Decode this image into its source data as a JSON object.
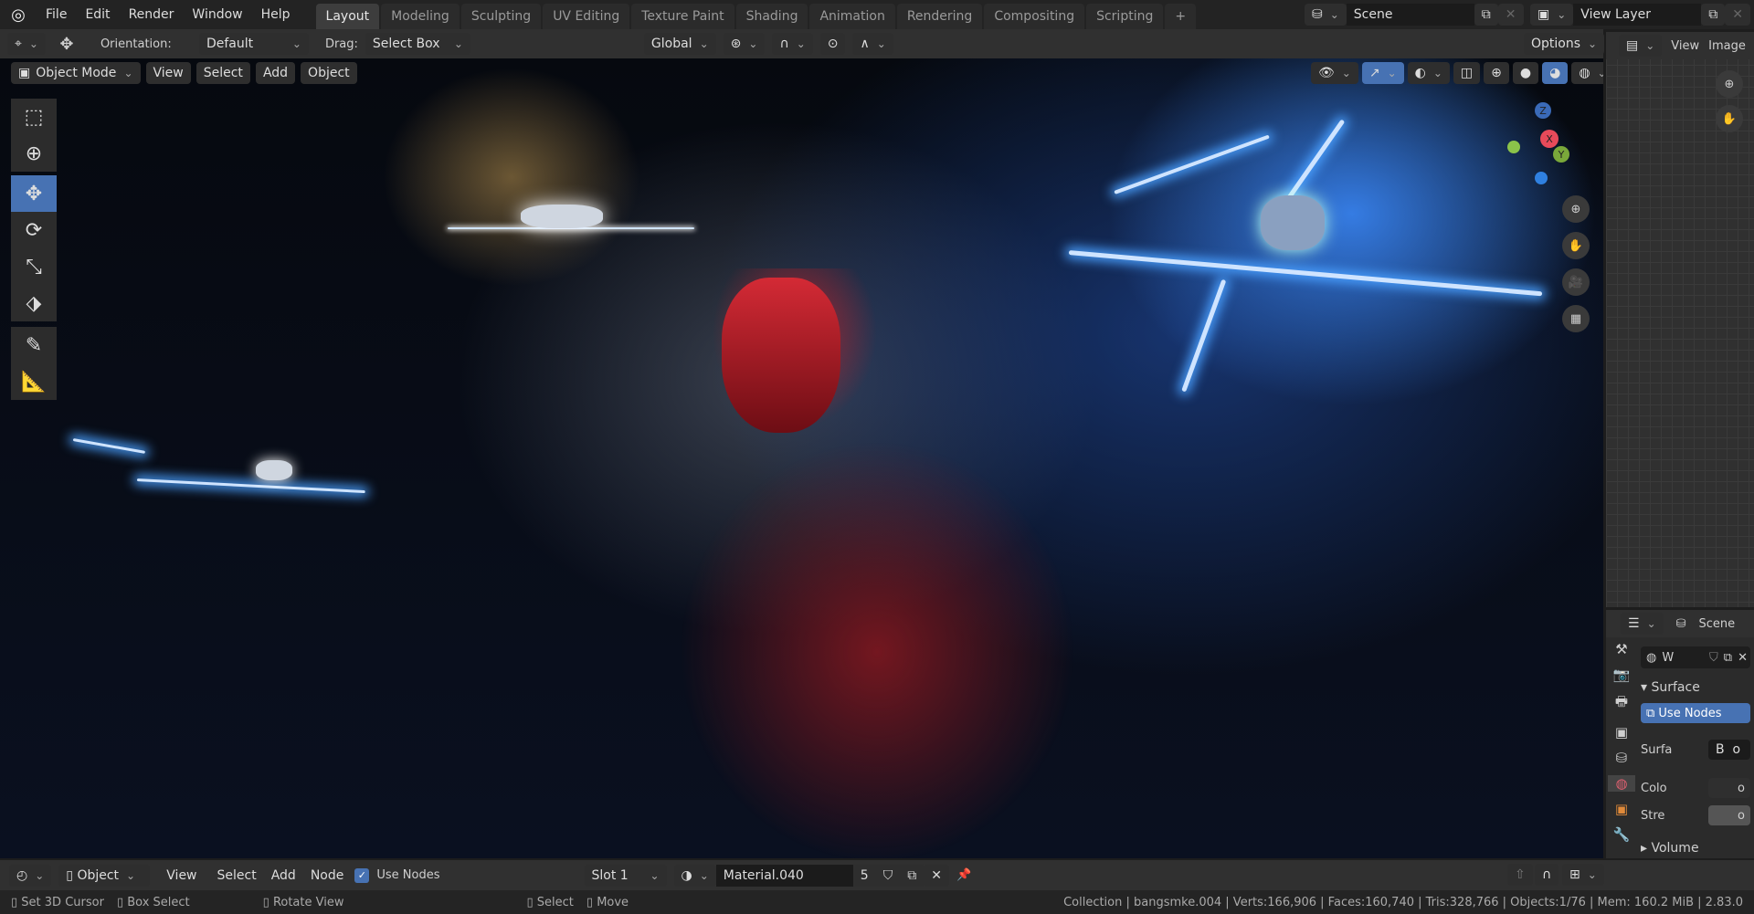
{
  "topbar": {
    "menus": [
      "File",
      "Edit",
      "Render",
      "Window",
      "Help"
    ],
    "workspaces": [
      "Layout",
      "Modeling",
      "Sculpting",
      "UV Editing",
      "Texture Paint",
      "Shading",
      "Animation",
      "Rendering",
      "Compositing",
      "Scripting"
    ],
    "add_tab": "+",
    "scene": "Scene",
    "view_layer": "View Layer"
  },
  "toolheader": {
    "orientation_label": "Orientation:",
    "orientation": "Default",
    "drag_label": "Drag:",
    "drag": "Select Box",
    "transform": "Global",
    "options": "Options"
  },
  "viewport": {
    "mode": "Object Mode",
    "menus": [
      "View",
      "Select",
      "Add",
      "Object"
    ],
    "gizmo": {
      "x": "X",
      "y": "Y",
      "z": "Z"
    }
  },
  "image_editor": {
    "menus": [
      "View",
      "Image"
    ]
  },
  "properties": {
    "scene": "Scene",
    "world": "W",
    "surface": "Surface",
    "use_nodes": "Use Nodes",
    "surface_label": "Surfa",
    "surface_value": "B",
    "color_label": "Colo",
    "strength_label": "Stre",
    "volume": "Volume",
    "socket": "o"
  },
  "node_header": {
    "mode": "Object",
    "menus": [
      "View",
      "Select",
      "Add",
      "Node"
    ],
    "use_nodes": "Use Nodes",
    "slot": "Slot 1",
    "material": "Material.040",
    "users": "5"
  },
  "status": {
    "left": [
      "Set 3D Cursor",
      "Box Select",
      "Rotate View",
      "Select",
      "Move"
    ],
    "stats": "Collection | bangsmke.004 | Verts:166,906 | Faces:160,740 | Tris:328,766 | Objects:1/76 | Mem: 160.2 MiB | 2.83.0"
  },
  "colors": {
    "accent": "#4772b3"
  }
}
